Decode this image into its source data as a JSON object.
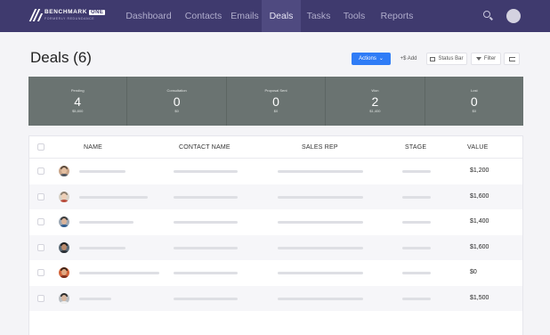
{
  "brand": {
    "name": "BENCHMARK",
    "badge": "ONE",
    "tagline": "FORMERLY REDUNDANCE"
  },
  "nav": {
    "items": [
      {
        "label": "Dashboard",
        "active": false
      },
      {
        "label": "Contacts",
        "active": false
      },
      {
        "label": "Emails",
        "active": false
      },
      {
        "label": "Deals",
        "active": true
      },
      {
        "label": "Tasks",
        "active": false
      },
      {
        "label": "Tools",
        "active": false
      },
      {
        "label": "Reports",
        "active": false
      }
    ],
    "search_icon": "search-icon",
    "avatar_icon": "user-avatar"
  },
  "page": {
    "title": "Deals (6)"
  },
  "toolbar": {
    "actions_label": "Actions",
    "add_label": "+$ Add",
    "status_bar_label": "Status Bar",
    "filter_label": "Filter",
    "export_icon": "export-icon"
  },
  "pipeline": [
    {
      "label": "Pending",
      "count": "4",
      "amount": "$5,800"
    },
    {
      "label": "Consultation",
      "count": "0",
      "amount": "$0"
    },
    {
      "label": "Proposal Sent",
      "count": "0",
      "amount": "$0"
    },
    {
      "label": "Won",
      "count": "2",
      "amount": "$1,400"
    },
    {
      "label": "Lost",
      "count": "0",
      "amount": "$0"
    }
  ],
  "table": {
    "headers": {
      "name": "NAME",
      "contact_name": "CONTACT NAME",
      "sales_rep": "SALES REP",
      "stage": "STAGE",
      "value": "VALUE"
    },
    "rows": [
      {
        "value": "$1,200"
      },
      {
        "value": "$1,600"
      },
      {
        "value": "$1,400"
      },
      {
        "value": "$1,600"
      },
      {
        "value": "$0"
      },
      {
        "value": "$1,500"
      }
    ]
  },
  "colors": {
    "nav_bg": "#3f3a6e",
    "accent": "#2f7cf6",
    "pipeline_bg": "#6a7371"
  }
}
